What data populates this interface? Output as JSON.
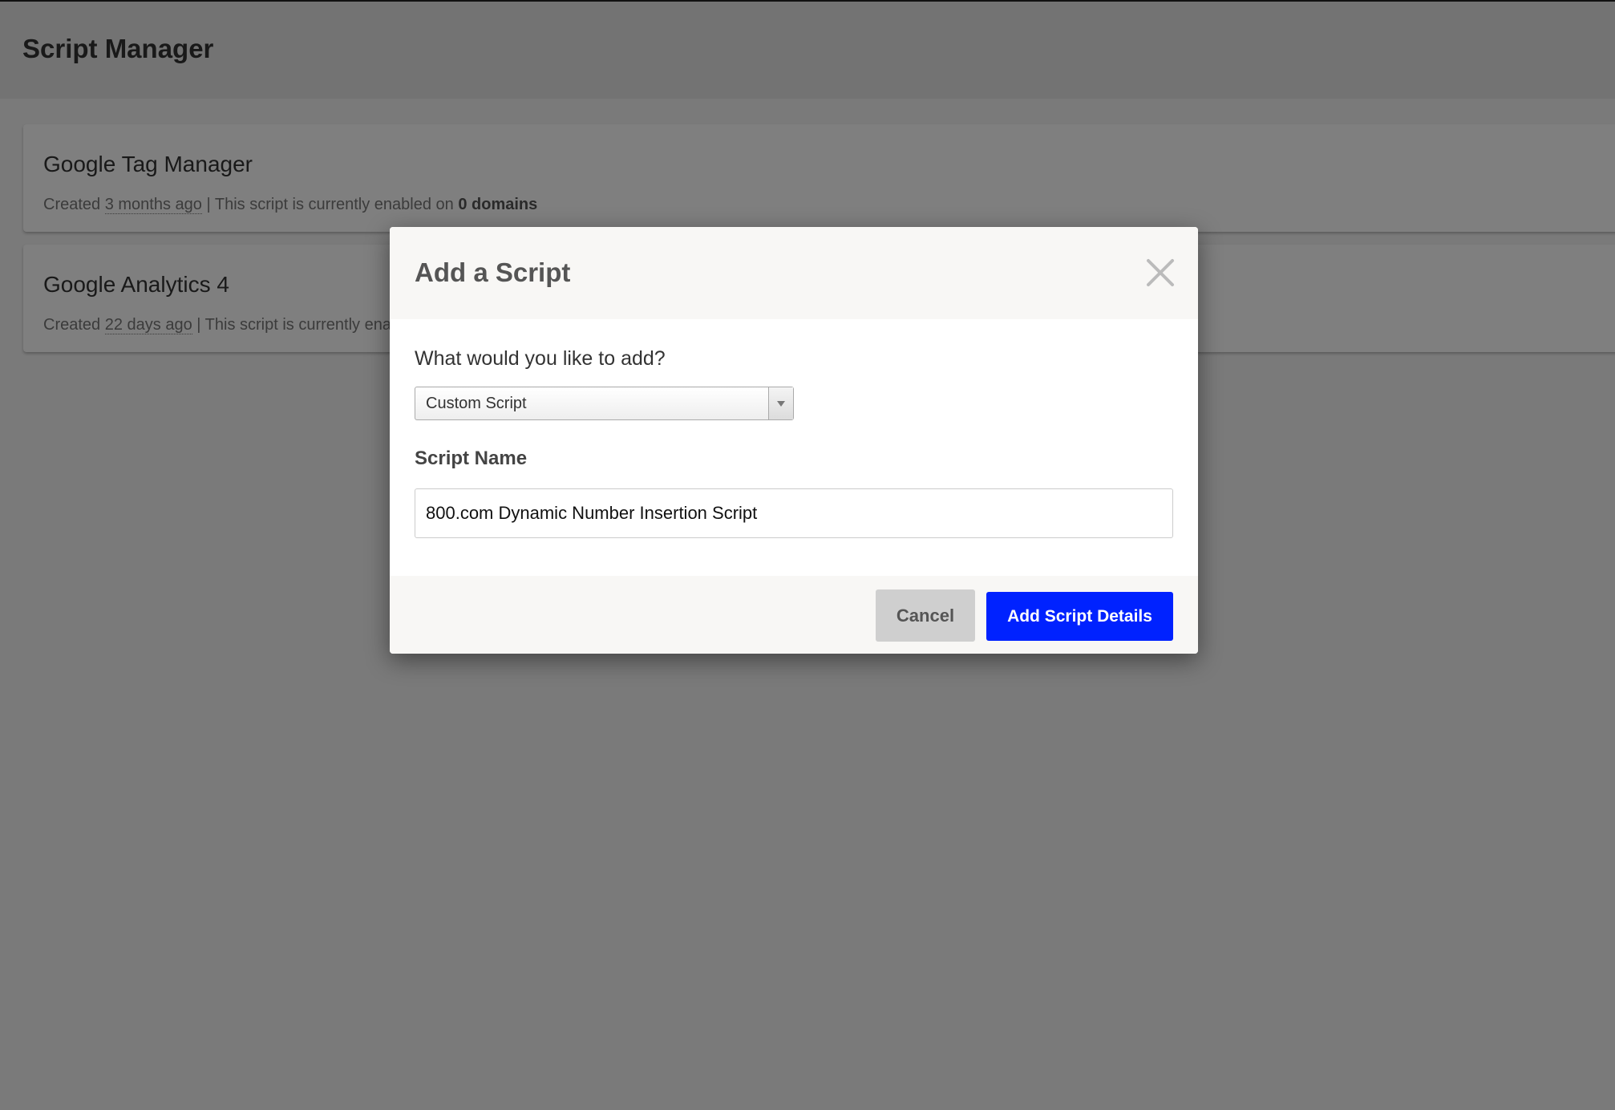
{
  "header": {
    "title": "Script Manager"
  },
  "scripts": [
    {
      "name": "Google Tag Manager",
      "created_prefix": "Created",
      "created_ago": "3 months ago",
      "separator": "| This script is currently enabled on",
      "domains": "0 domains"
    },
    {
      "name": "Google Analytics 4",
      "created_prefix": "Created",
      "created_ago": "22 days ago",
      "separator": "| This script is currently enabl",
      "domains": ""
    }
  ],
  "modal": {
    "title": "Add a Script",
    "close_icon": "close-icon",
    "question_label": "What would you like to add?",
    "type_select": {
      "selected": "Custom Script"
    },
    "name_label": "Script Name",
    "name_input": {
      "value": "800.com Dynamic Number Insertion Script"
    },
    "cancel_label": "Cancel",
    "submit_label": "Add Script Details"
  },
  "colors": {
    "primary_button": "#0022ff",
    "cancel_button": "#cfcfcf",
    "overlay": "rgba(0,0,0,0.5)"
  }
}
